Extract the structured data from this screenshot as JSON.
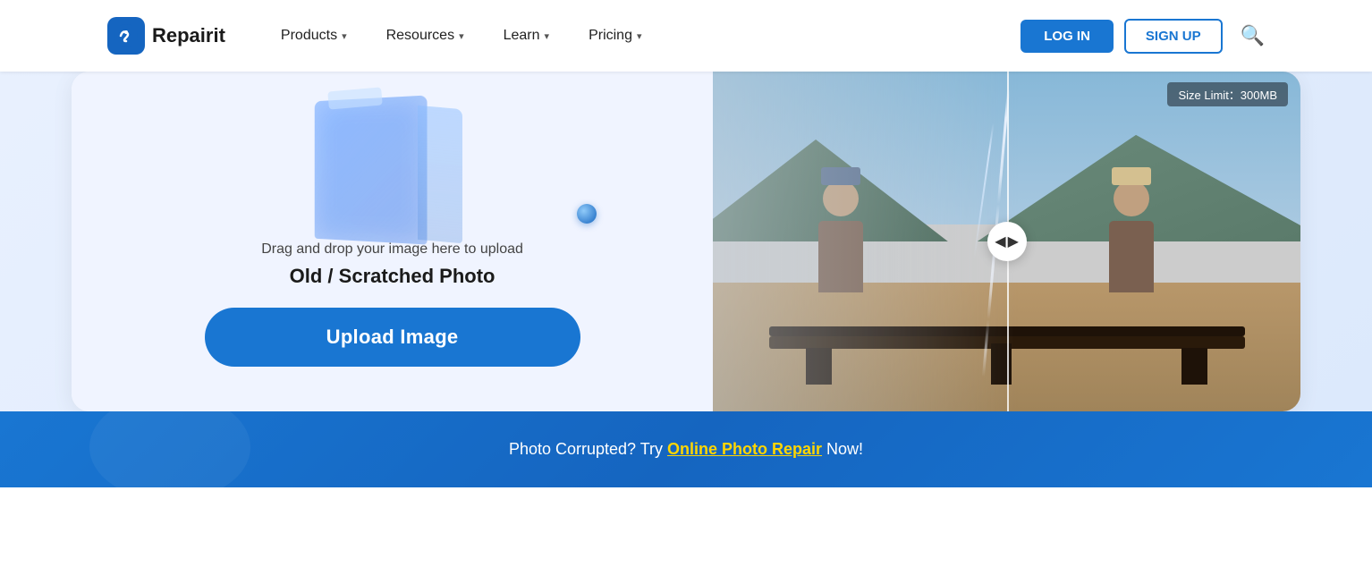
{
  "nav": {
    "logo_text": "Repairit",
    "items": [
      {
        "label": "Products",
        "id": "products"
      },
      {
        "label": "Resources",
        "id": "resources"
      },
      {
        "label": "Learn",
        "id": "learn"
      },
      {
        "label": "Pricing",
        "id": "pricing"
      }
    ],
    "login_label": "LOG IN",
    "signup_label": "SIGN UP"
  },
  "upload_section": {
    "drag_text": "Drag and drop your image here to upload",
    "photo_type": "Old / Scratched Photo",
    "upload_button": "Upload Image"
  },
  "photo_panel": {
    "size_limit": "Size Limit：300MB"
  },
  "bottom_bar": {
    "prefix": "Photo Corrupted?  Try ",
    "link_text": "Online Photo Repair",
    "suffix": " Now!"
  }
}
